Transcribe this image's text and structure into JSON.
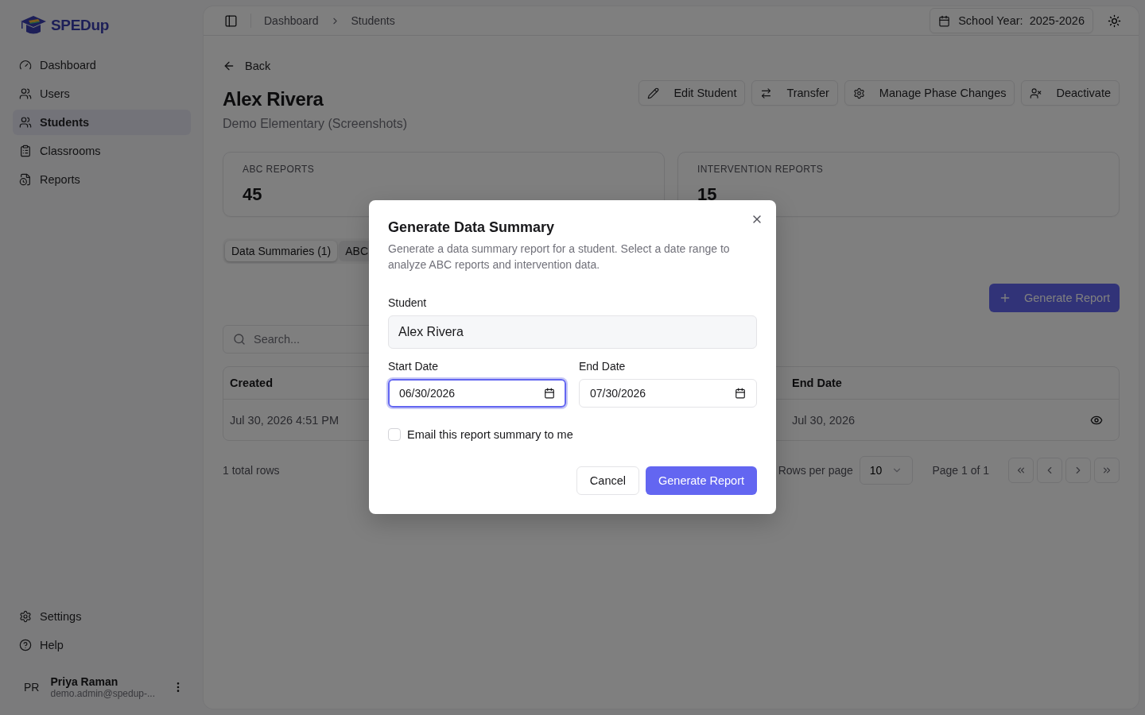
{
  "logo": {
    "text": "SPEDup"
  },
  "sidebar": {
    "items": [
      {
        "label": "Dashboard",
        "selected": false
      },
      {
        "label": "Users",
        "selected": false
      },
      {
        "label": "Students",
        "selected": true
      },
      {
        "label": "Classrooms",
        "selected": false
      },
      {
        "label": "Reports",
        "selected": false
      }
    ],
    "footer_items": [
      {
        "label": "Settings"
      },
      {
        "label": "Help"
      }
    ],
    "user": {
      "initials": "PR",
      "name": "Priya Raman",
      "email": "demo.admin@spedup-..."
    }
  },
  "header": {
    "breadcrumbs": [
      "Dashboard",
      "Students"
    ],
    "school_year_label": "School Year:",
    "school_year": "2025-2026"
  },
  "back": "Back",
  "student": {
    "name": "Alex Rivera",
    "school": "Demo Elementary (Screenshots)"
  },
  "actions": [
    {
      "label": "Edit Student"
    },
    {
      "label": "Transfer"
    },
    {
      "label": "Manage Phase Changes"
    },
    {
      "label": "Deactivate"
    }
  ],
  "stats": [
    {
      "label": "ABC REPORTS",
      "value": "45"
    },
    {
      "label": "INTERVENTION REPORTS",
      "value": "15"
    }
  ],
  "tabs": [
    {
      "label": "Data Summaries (1)",
      "selected": true
    },
    {
      "label": "ABC",
      "selected": false
    }
  ],
  "generate_button": "Generate Report",
  "search": {
    "placeholder": "Search..."
  },
  "table": {
    "columns": [
      "Created",
      "End Date"
    ],
    "rows": [
      {
        "cells": [
          "Jul 30, 2026 4:51 PM",
          "Jul 30, 2026"
        ]
      }
    ]
  },
  "pagination": {
    "total": "1 total rows",
    "rows_per_page_label": "Rows per page",
    "rows_per_page": "10",
    "page": "Page 1 of 1"
  },
  "dialog": {
    "title": "Generate Data Summary",
    "description": "Generate a data summary report for a student. Select a date range to analyze ABC reports and intervention data.",
    "student_label": "Student",
    "student_value": "Alex Rivera",
    "dates": [
      {
        "label": "Start Date",
        "value": "06/30/2026",
        "focused": true
      },
      {
        "label": "End Date",
        "value": "07/30/2026",
        "focused": false
      }
    ],
    "email_checkbox": {
      "label": "Email this report summary to me",
      "checked": false
    },
    "buttons": [
      {
        "label": "Cancel",
        "kind": "secondary"
      },
      {
        "label": "Generate Report",
        "kind": "primary"
      }
    ]
  }
}
